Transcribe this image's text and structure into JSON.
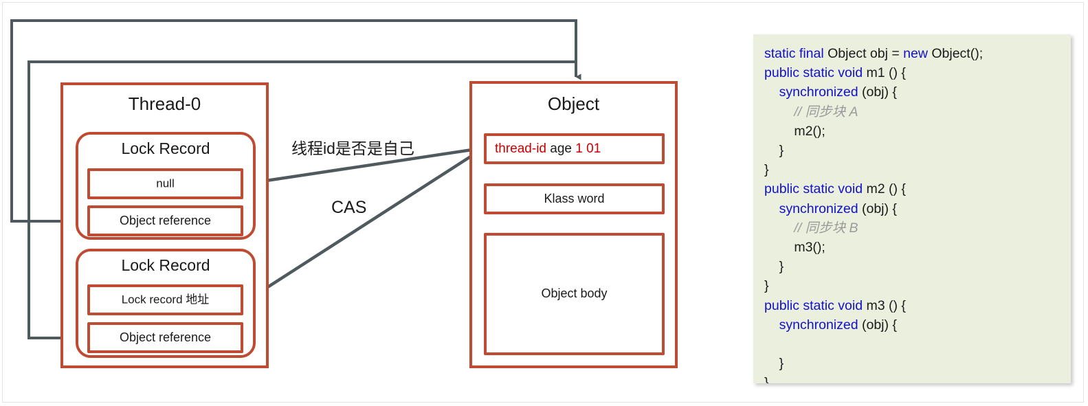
{
  "diagram": {
    "thread": {
      "title": "Thread-0",
      "lock_records": [
        {
          "title": "Lock Record",
          "slot_mark": "null",
          "slot_ref": "Object reference"
        },
        {
          "title": "Lock Record",
          "slot_mark": "Lock record 地址",
          "slot_ref": "Object reference"
        }
      ]
    },
    "object": {
      "title": "Object",
      "mark_word": {
        "thread_id": "thread-id",
        "age": "age",
        "biased_bit": "1",
        "lock_bits": "01"
      },
      "klass_word": "Klass word",
      "object_body": "Object body"
    },
    "arrow_labels": {
      "thread_id_check": "线程id是否是自己",
      "cas": "CAS"
    },
    "colors": {
      "box_border": "#BF4B32",
      "connector": "#4F5A5E",
      "mark_word_red": "#CC0000",
      "code_background": "#EBEFDD",
      "code_keyword": "#1111CC",
      "code_comment": "#9a9a9a"
    }
  },
  "code_panel": {
    "language": "java",
    "lines": [
      [
        {
          "t": "static final ",
          "c": "kw"
        },
        {
          "t": "Object obj = ",
          "c": "pl"
        },
        {
          "t": "new ",
          "c": "kw"
        },
        {
          "t": "Object();",
          "c": "pl"
        }
      ],
      [
        {
          "t": "public static void ",
          "c": "kw"
        },
        {
          "t": "m1 () {",
          "c": "pl"
        }
      ],
      [
        {
          "t": "    ",
          "c": "pl"
        },
        {
          "t": "synchronized ",
          "c": "kw"
        },
        {
          "t": "(obj) {",
          "c": "pl"
        }
      ],
      [
        {
          "t": "        // 同步块 A",
          "c": "cm"
        }
      ],
      [
        {
          "t": "        m2();",
          "c": "pl"
        }
      ],
      [
        {
          "t": "    }",
          "c": "pl"
        }
      ],
      [
        {
          "t": "}",
          "c": "pl"
        }
      ],
      [
        {
          "t": "public static void ",
          "c": "kw"
        },
        {
          "t": "m2 () {",
          "c": "pl"
        }
      ],
      [
        {
          "t": "    ",
          "c": "pl"
        },
        {
          "t": "synchronized ",
          "c": "kw"
        },
        {
          "t": "(obj) {",
          "c": "pl"
        }
      ],
      [
        {
          "t": "        // 同步块 B",
          "c": "cm"
        }
      ],
      [
        {
          "t": "        m3();",
          "c": "pl"
        }
      ],
      [
        {
          "t": "    }",
          "c": "pl"
        }
      ],
      [
        {
          "t": "}",
          "c": "pl"
        }
      ],
      [
        {
          "t": "public static void ",
          "c": "kw"
        },
        {
          "t": "m3 () {",
          "c": "pl"
        }
      ],
      [
        {
          "t": "    ",
          "c": "pl"
        },
        {
          "t": "synchronized ",
          "c": "kw"
        },
        {
          "t": "(obj) {",
          "c": "pl"
        }
      ],
      [
        {
          "t": "",
          "c": "pl"
        }
      ],
      [
        {
          "t": "    }",
          "c": "pl"
        }
      ],
      [
        {
          "t": "}",
          "c": "pl"
        }
      ]
    ]
  }
}
